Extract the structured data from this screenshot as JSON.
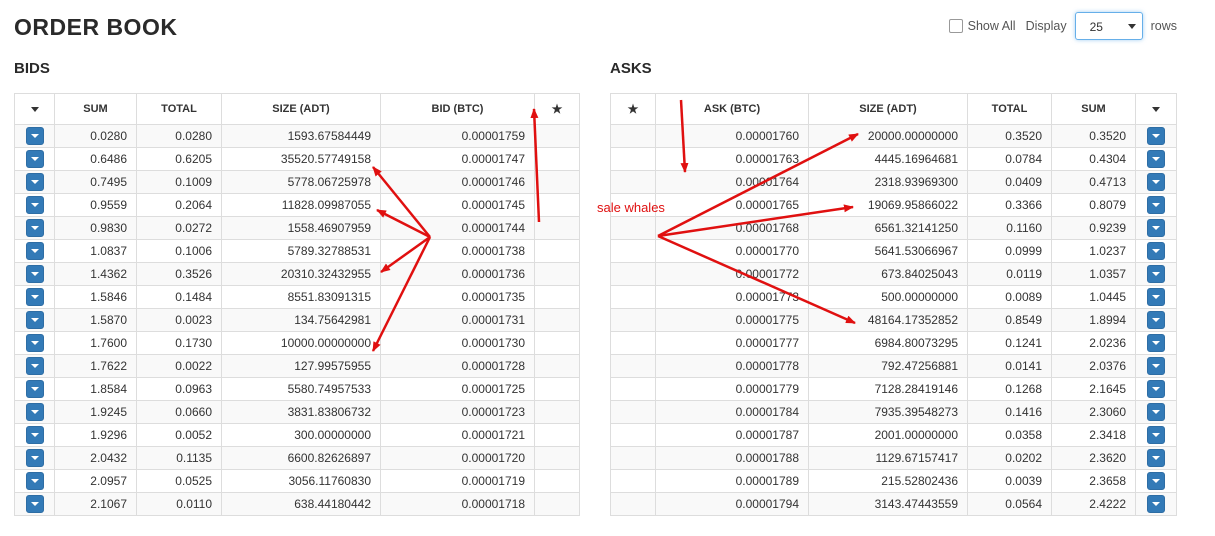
{
  "title": "ORDER BOOK",
  "controls": {
    "show_all_label": "Show All",
    "display_label": "Display",
    "display_value": "25",
    "rows_label": "rows"
  },
  "bids": {
    "title": "BIDS",
    "columns": [
      "SUM",
      "TOTAL",
      "SIZE (ADT)",
      "BID (BTC)"
    ],
    "rows": [
      [
        "0.0280",
        "0.0280",
        "1593.67584449",
        "0.00001759"
      ],
      [
        "0.6486",
        "0.6205",
        "35520.57749158",
        "0.00001747"
      ],
      [
        "0.7495",
        "0.1009",
        "5778.06725978",
        "0.00001746"
      ],
      [
        "0.9559",
        "0.2064",
        "11828.09987055",
        "0.00001745"
      ],
      [
        "0.9830",
        "0.0272",
        "1558.46907959",
        "0.00001744"
      ],
      [
        "1.0837",
        "0.1006",
        "5789.32788531",
        "0.00001738"
      ],
      [
        "1.4362",
        "0.3526",
        "20310.32432955",
        "0.00001736"
      ],
      [
        "1.5846",
        "0.1484",
        "8551.83091315",
        "0.00001735"
      ],
      [
        "1.5870",
        "0.0023",
        "134.75642981",
        "0.00001731"
      ],
      [
        "1.7600",
        "0.1730",
        "10000.00000000",
        "0.00001730"
      ],
      [
        "1.7622",
        "0.0022",
        "127.99575955",
        "0.00001728"
      ],
      [
        "1.8584",
        "0.0963",
        "5580.74957533",
        "0.00001725"
      ],
      [
        "1.9245",
        "0.0660",
        "3831.83806732",
        "0.00001723"
      ],
      [
        "1.9296",
        "0.0052",
        "300.00000000",
        "0.00001721"
      ],
      [
        "2.0432",
        "0.1135",
        "6600.82626897",
        "0.00001720"
      ],
      [
        "2.0957",
        "0.0525",
        "3056.11760830",
        "0.00001719"
      ],
      [
        "2.1067",
        "0.0110",
        "638.44180442",
        "0.00001718"
      ]
    ]
  },
  "asks": {
    "title": "ASKS",
    "columns": [
      "ASK (BTC)",
      "SIZE (ADT)",
      "TOTAL",
      "SUM"
    ],
    "rows": [
      [
        "0.00001760",
        "20000.00000000",
        "0.3520",
        "0.3520"
      ],
      [
        "0.00001763",
        "4445.16964681",
        "0.0784",
        "0.4304"
      ],
      [
        "0.00001764",
        "2318.93969300",
        "0.0409",
        "0.4713"
      ],
      [
        "0.00001765",
        "19069.95866022",
        "0.3366",
        "0.8079"
      ],
      [
        "0.00001768",
        "6561.32141250",
        "0.1160",
        "0.9239"
      ],
      [
        "0.00001770",
        "5641.53066967",
        "0.0999",
        "1.0237"
      ],
      [
        "0.00001772",
        "673.84025043",
        "0.0119",
        "1.0357"
      ],
      [
        "0.00001773",
        "500.00000000",
        "0.0089",
        "1.0445"
      ],
      [
        "0.00001775",
        "48164.17352852",
        "0.8549",
        "1.8994"
      ],
      [
        "0.00001777",
        "6984.80073295",
        "0.1241",
        "2.0236"
      ],
      [
        "0.00001778",
        "792.47256881",
        "0.0141",
        "2.0376"
      ],
      [
        "0.00001779",
        "7128.28419146",
        "0.1268",
        "2.1645"
      ],
      [
        "0.00001784",
        "7935.39548273",
        "0.1416",
        "2.3060"
      ],
      [
        "0.00001787",
        "2001.00000000",
        "0.0358",
        "2.3418"
      ],
      [
        "0.00001788",
        "1129.67157417",
        "0.0202",
        "2.3620"
      ],
      [
        "0.00001789",
        "215.52802436",
        "0.0039",
        "2.3658"
      ],
      [
        "0.00001794",
        "3143.47443559",
        "0.0564",
        "2.4222"
      ]
    ]
  },
  "annotation": {
    "text": "sale whales",
    "color": "#e01010"
  },
  "colors": {
    "row_button": "#337ab7",
    "arrow": "#e01010"
  }
}
